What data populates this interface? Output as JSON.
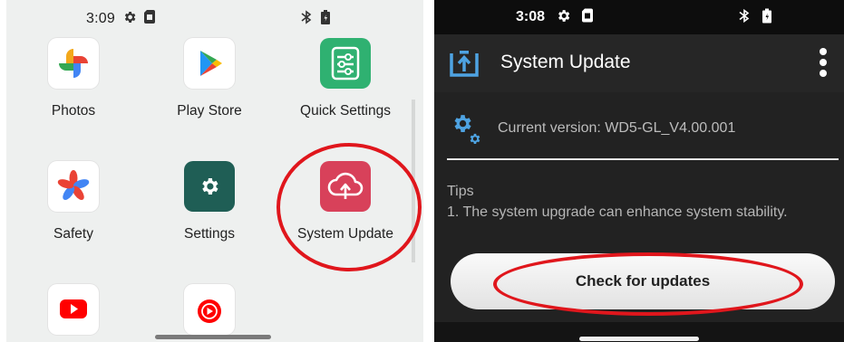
{
  "left_screen": {
    "status_time": "3:09",
    "apps": [
      {
        "label": "Photos"
      },
      {
        "label": "Play Store"
      },
      {
        "label": "Quick Settings"
      },
      {
        "label": "Safety"
      },
      {
        "label": "Settings"
      },
      {
        "label": "System Update"
      }
    ]
  },
  "right_screen": {
    "status_time": "3:08",
    "title": "System Update",
    "current_version": "Current version: WD5-GL_V4.00.001",
    "tips_heading": "Tips",
    "tip_1": "1. The system upgrade can enhance system stability.",
    "check_button": "Check for updates"
  },
  "colors": {
    "annotation_red": "#e0161c",
    "system_update_icon": "#d8415a",
    "settings_tile": "#1f5e55",
    "update_icon_blue": "#4ea3e2"
  }
}
